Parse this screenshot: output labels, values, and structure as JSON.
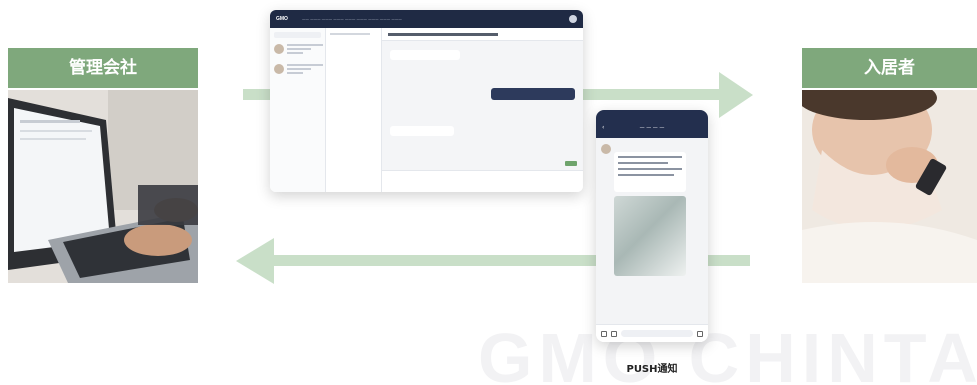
{
  "labels": {
    "management": "管理会社",
    "resident": "入居者"
  },
  "push_label": "PUSH通知",
  "watermark": "GMO CHINTAI",
  "colors": {
    "label_green": "#7fa87c",
    "arrow_green": "#c9dfc8",
    "nav_navy": "#1f2a44"
  },
  "icons": [
    "laptop-photo",
    "smartphone-user-photo",
    "arrow-right",
    "arrow-left"
  ]
}
